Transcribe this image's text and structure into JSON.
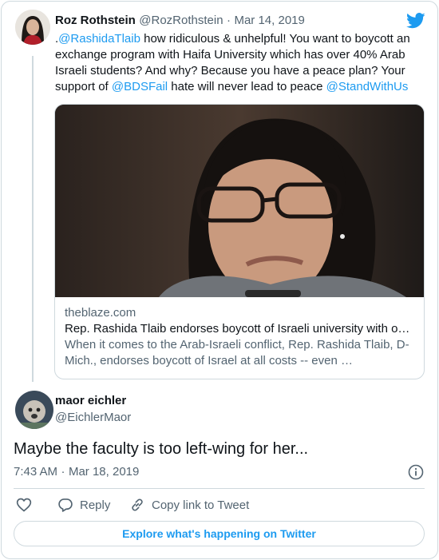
{
  "quoted_tweet": {
    "author_name": "Roz Rothstein",
    "author_handle": "@RozRothstein",
    "separator": "·",
    "date": "Mar 14, 2019",
    "text_prefix": ".",
    "mention_1": "@RashidaTlaib",
    "text_1": "  how ridiculous & unhelpful!  You want to boycott an exchange program with Haifa University which has over 40% Arab Israeli students? And why? Because you have a peace plan? Your support of ",
    "mention_2": "@BDSFail",
    "text_2": " hate will never lead to peace ",
    "mention_3": "@StandWithUs"
  },
  "link_card": {
    "domain": "theblaze.com",
    "title": "Rep. Rashida Tlaib endorses boycott of Israeli university with o…",
    "description": "When it comes to the Arab-Israeli conflict, Rep. Rashida Tlaib, D-Mich., endorses boycott of Israel at all costs -- even …"
  },
  "reply_tweet": {
    "author_name": "maor eichler",
    "author_handle": "@EichlerMaor",
    "text": "Maybe the faculty is too left-wing for her...",
    "time": "7:43 AM",
    "separator": "·",
    "date": "Mar 18, 2019"
  },
  "actions": {
    "reply_label": "Reply",
    "copy_label": "Copy link to Tweet"
  },
  "explore_label": "Explore what's happening on Twitter",
  "icons": {
    "brand": "twitter-bird-icon",
    "info": "info-icon",
    "like": "heart-icon",
    "reply": "reply-bubble-icon",
    "copy": "link-icon"
  },
  "colors": {
    "accent": "#1d9bf0",
    "text": "#0f1419",
    "muted": "#536471",
    "border": "#cfd9de"
  }
}
